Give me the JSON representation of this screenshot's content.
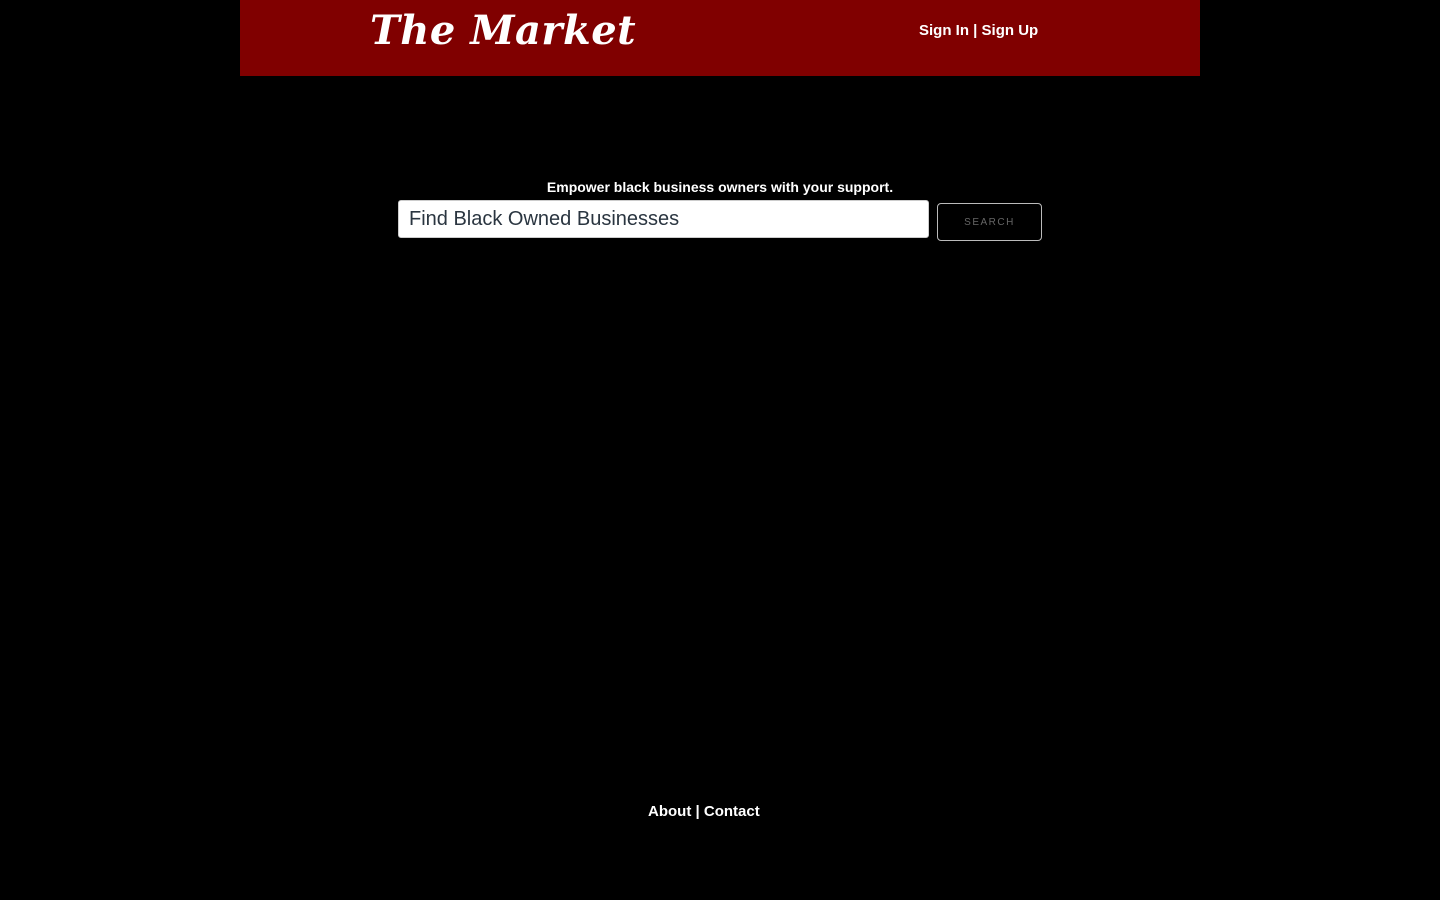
{
  "header": {
    "logo_text": "The Market",
    "sign_in_label": "Sign In",
    "separator": "|",
    "sign_up_label": "Sign Up"
  },
  "hero": {
    "tagline": "Empower black business owners with your support."
  },
  "search": {
    "placeholder": "Find Black Owned Businesses",
    "button_label": "SEARCH"
  },
  "footer": {
    "about_label": "About",
    "separator": "|",
    "contact_label": "Contact"
  },
  "colors": {
    "header_background": "#800000",
    "page_background": "#000000",
    "text": "#ffffff"
  }
}
